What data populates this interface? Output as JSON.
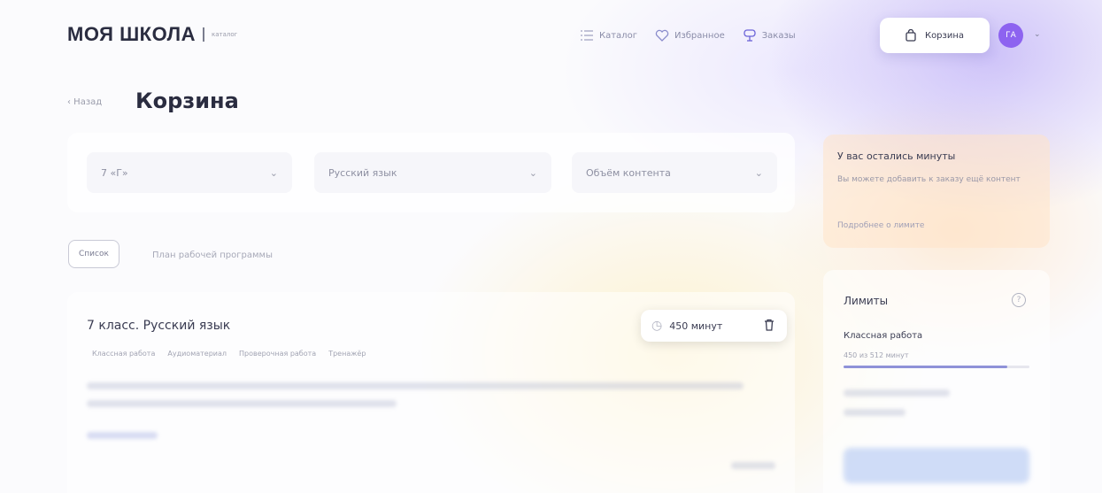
{
  "header": {
    "logo": "МОЯ ШКОЛА",
    "logo_sub": "каталог",
    "nav": [
      {
        "label": "Каталог",
        "icon": "list-icon"
      },
      {
        "label": "Избранное",
        "icon": "heart-icon"
      },
      {
        "label": "Заказы",
        "icon": "orders-icon"
      }
    ],
    "cart_label": "Корзина",
    "avatar_initials": "ГА"
  },
  "page": {
    "back_label": "‹ Назад",
    "title": "Корзина"
  },
  "filters": {
    "class": "7 «Г»",
    "subject": "Русский язык",
    "volume": "Объём контента"
  },
  "view_tabs": {
    "active": "Список",
    "other": "План рабочей программы"
  },
  "course": {
    "title": "7 класс. Русский язык",
    "tags": [
      "Классная работа",
      "Аудиоматериал",
      "Проверочная работа",
      "Тренажёр"
    ],
    "minutes": "450 минут"
  },
  "notice": {
    "title": "У вас остались минуты",
    "text": "Вы можете добавить к заказу ещё контент",
    "link": "Подробнее о лимите"
  },
  "limits": {
    "title": "Лимиты",
    "items": [
      {
        "label": "Классная работа",
        "value": "450 из 512 минут",
        "progress": 0.88
      }
    ]
  },
  "colors": {
    "accent": "#8d63f0",
    "progress": "#8f92d8"
  }
}
